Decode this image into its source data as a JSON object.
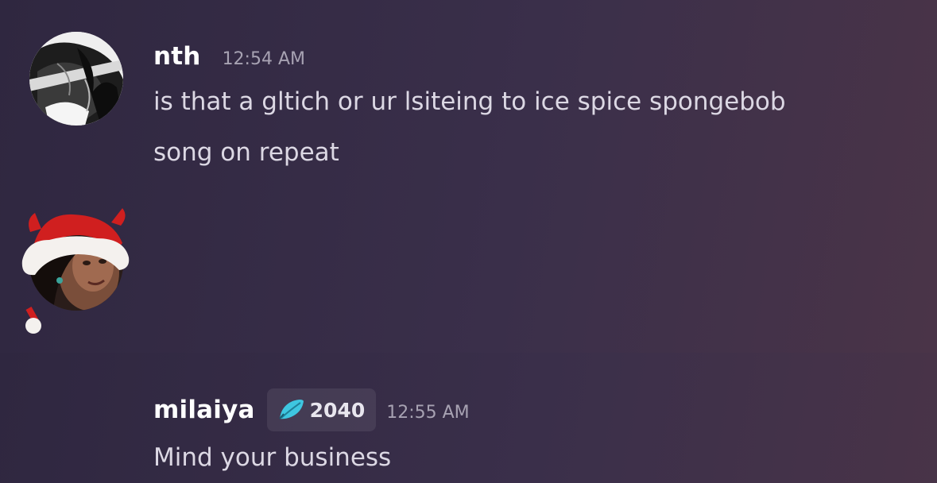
{
  "messages": [
    {
      "username": "nth",
      "timestamp": "12:54 AM",
      "content_line1": "is that a gltich or ur lsiteing to ice spice spongebob",
      "content_line2": "song on repeat",
      "avatar": "anime-manga-avatar"
    },
    {
      "username": "milaiya",
      "timestamp": "12:55 AM",
      "badge": {
        "icon": "feather-icon",
        "value": "2040",
        "color": "#3ec6e0"
      },
      "content": "Mind your business",
      "avatar": "photo-avatar-with-santa-hat"
    }
  ],
  "colors": {
    "username": "#ffffff",
    "timestamp": "#a7a2b2",
    "message_text": "#dcd8e4",
    "background_start": "#2f2740",
    "background_end": "#4a3448"
  }
}
